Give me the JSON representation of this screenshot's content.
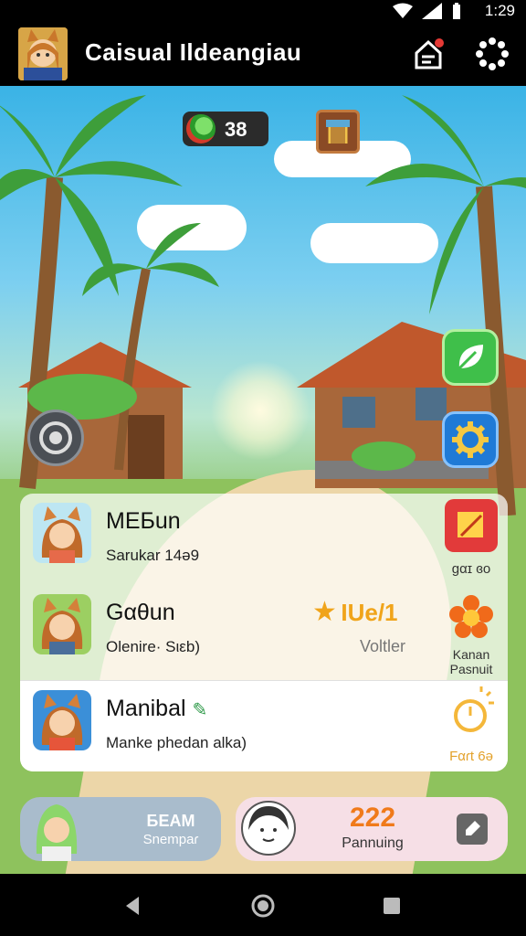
{
  "status_bar": {
    "time": "1:29"
  },
  "app_bar": {
    "title": "Caisual Ildeangiau",
    "icons": [
      "avatar",
      "home-notification-icon",
      "settings-dots-icon"
    ]
  },
  "hud": {
    "gem_count": "38",
    "shop_icon": "shop-icon"
  },
  "side_buttons": [
    "leaf-icon",
    "gear-icon"
  ],
  "camera_button": "camera-icon",
  "list": [
    {
      "name": "MEБun",
      "subtitle": "Sarukar 14ə9",
      "action_label": "gαɪ ɞo",
      "action_icon": "note-icon",
      "action_color": "#e23a3a"
    },
    {
      "name": "Gαθun",
      "subtitle": "Olenire· Sιεb)",
      "badge": "IUe/1",
      "badge_sub": "Voltler",
      "action_label": "Kanan\nPasnuit",
      "action_icon": "flower-icon",
      "action_color": "#f06a1a"
    },
    {
      "name": "Manibal",
      "subtitle": "Manke phedan alka)",
      "action_label": "Fαɾt 6ə",
      "action_icon": "timer-icon",
      "action_color": "#f4b73a"
    }
  ],
  "bottom_left": {
    "title": "ƂEAM",
    "subtitle": "Snempaɾ"
  },
  "bottom_right": {
    "title": "222",
    "subtitle": "Pannuing"
  },
  "nav": [
    "back-icon",
    "home-icon",
    "recents-icon"
  ]
}
